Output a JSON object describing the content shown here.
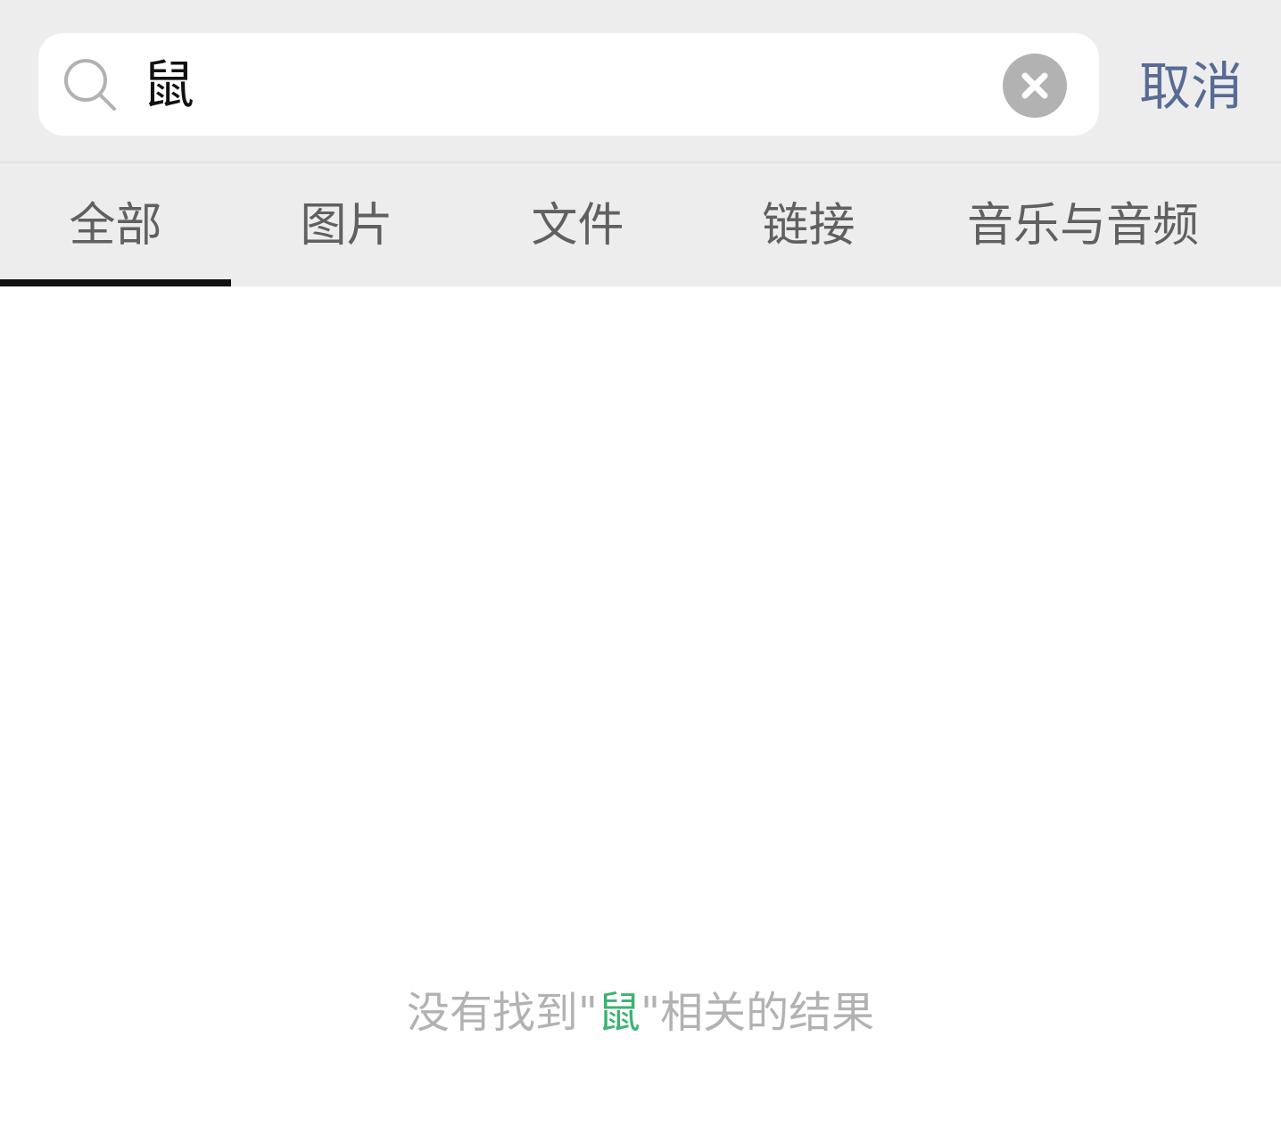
{
  "search": {
    "query": "鼠",
    "cancel_label": "取消"
  },
  "tabs": [
    {
      "label": "全部",
      "active": true
    },
    {
      "label": "图片",
      "active": false
    },
    {
      "label": "文件",
      "active": false
    },
    {
      "label": "链接",
      "active": false
    },
    {
      "label": "音乐与音频",
      "active": false
    }
  ],
  "empty_state": {
    "prefix": "没有找到\"",
    "keyword": "鼠",
    "suffix": "\"相关的结果"
  },
  "colors": {
    "cancel_link": "#576b95",
    "keyword_highlight": "#3cb371",
    "muted_text": "#b2b2b2"
  },
  "icons": {
    "search": "search-icon",
    "clear": "clear-icon"
  }
}
